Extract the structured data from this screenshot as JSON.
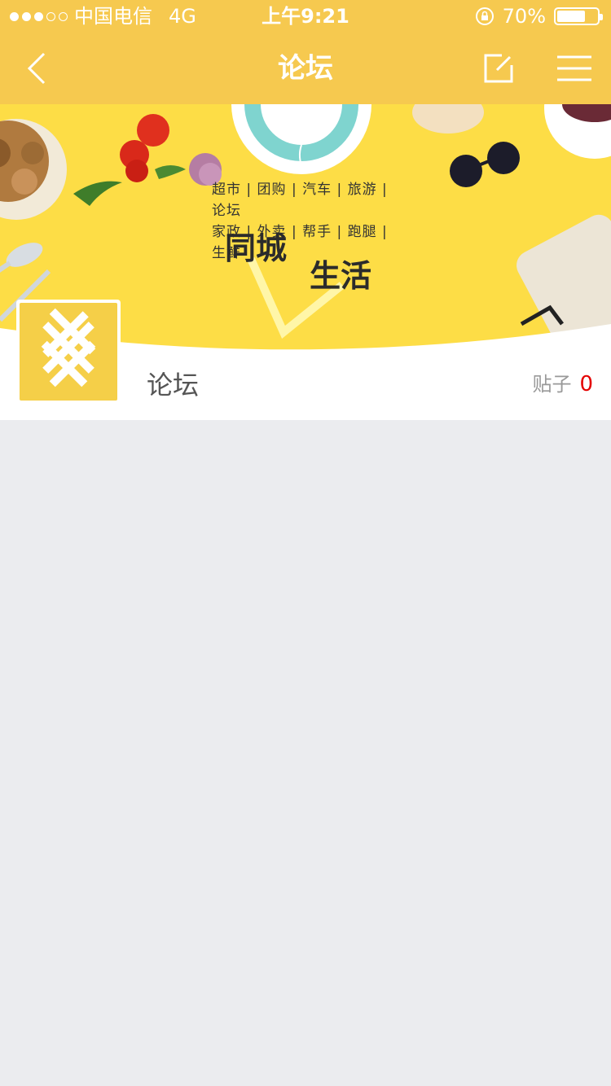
{
  "status_bar": {
    "carrier": "中国电信",
    "network": "4G",
    "time": "上午9:21",
    "battery": "70%",
    "battery_level": 0.7,
    "signal_strength": 3
  },
  "nav": {
    "title": "论坛"
  },
  "banner": {
    "tags_line1": "超市 | 团购 | 汽车 | 旅游 | 论坛",
    "tags_line2": "家政 | 外卖 | 帮手 | 跑腿 | 生鲜",
    "slogan_part1": "同城",
    "slogan_part2": "生活"
  },
  "forum": {
    "name": "论坛",
    "posts_label": "贴子",
    "posts_count": "0"
  },
  "colors": {
    "brand_yellow": "#f6c94f",
    "banner_yellow": "#fddd46",
    "count_red": "#e40000"
  }
}
